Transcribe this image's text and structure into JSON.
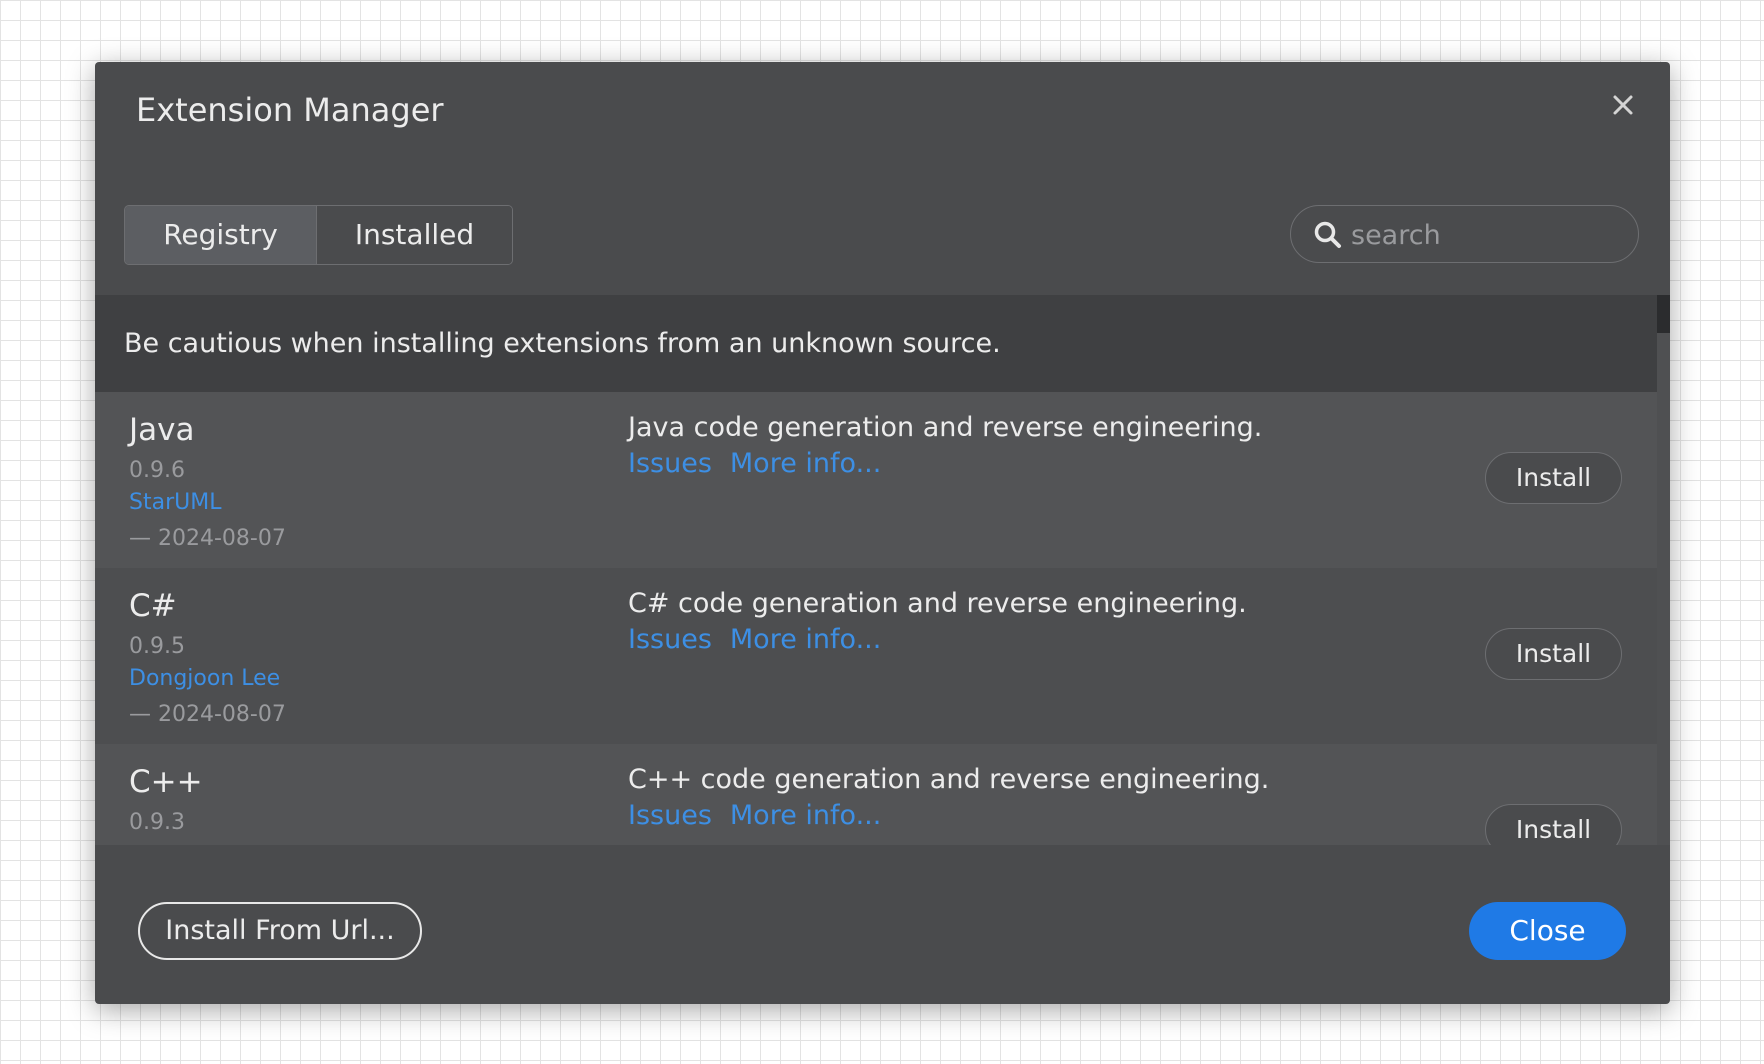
{
  "dialog": {
    "title": "Extension Manager"
  },
  "tabs": {
    "registry": "Registry",
    "installed": "Installed"
  },
  "search": {
    "placeholder": "search",
    "value": ""
  },
  "warning": "Be cautious when installing extensions from an unknown source.",
  "extensions": [
    {
      "name": "Java",
      "version": "0.9.6",
      "author": "StarUML",
      "date": "— 2024-08-07",
      "description": "Java code generation and reverse engineering.",
      "issues_label": "Issues",
      "more_label": "More info...",
      "action_label": "Install"
    },
    {
      "name": "C#",
      "version": "0.9.5",
      "author": "Dongjoon Lee",
      "date": "— 2024-08-07",
      "description": "C# code generation and reverse engineering.",
      "issues_label": "Issues",
      "more_label": "More info...",
      "action_label": "Install"
    },
    {
      "name": "C++",
      "version": "0.9.3",
      "author": "",
      "date": "",
      "description": "C++ code generation and reverse engineering.",
      "issues_label": "Issues",
      "more_label": "More info...",
      "action_label": "Install"
    }
  ],
  "footer": {
    "install_from_url": "Install From Url...",
    "close": "Close"
  },
  "colors": {
    "dialog_bg": "#4a4b4d",
    "link": "#3d8fe4",
    "primary": "#1f7ae6"
  },
  "icons": {
    "close": "close-icon",
    "search": "search-icon"
  }
}
